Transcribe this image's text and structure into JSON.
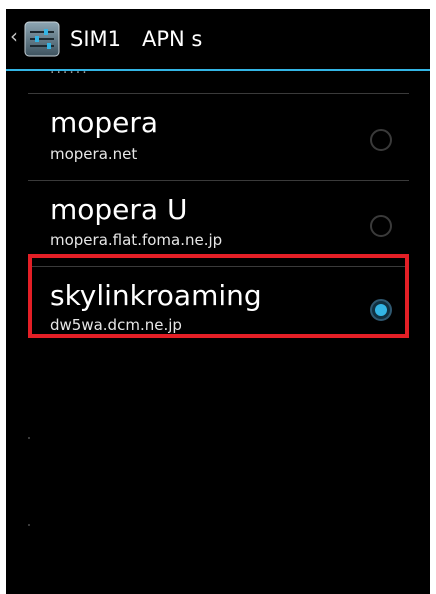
{
  "window": {
    "title": "SIM1 APN s"
  },
  "action_bar": {
    "up_caret": "‹",
    "app_icon": "settings-icon"
  },
  "list": {
    "partial_item_text": "......"
  },
  "apns": [
    {
      "name": "mopera",
      "address": "mopera.net",
      "selected": false
    },
    {
      "name": "mopera U",
      "address": "mopera.flat.foma.ne.jp",
      "selected": false
    },
    {
      "name": "skylinkroaming",
      "address": "dw5wa.dcm.ne.jp",
      "selected": true
    }
  ],
  "colors": {
    "background": "#000000",
    "accent": "#33b5e5",
    "highlight": "#e31f26",
    "text_primary": "#ffffff",
    "text_secondary": "#e6e6e6"
  }
}
